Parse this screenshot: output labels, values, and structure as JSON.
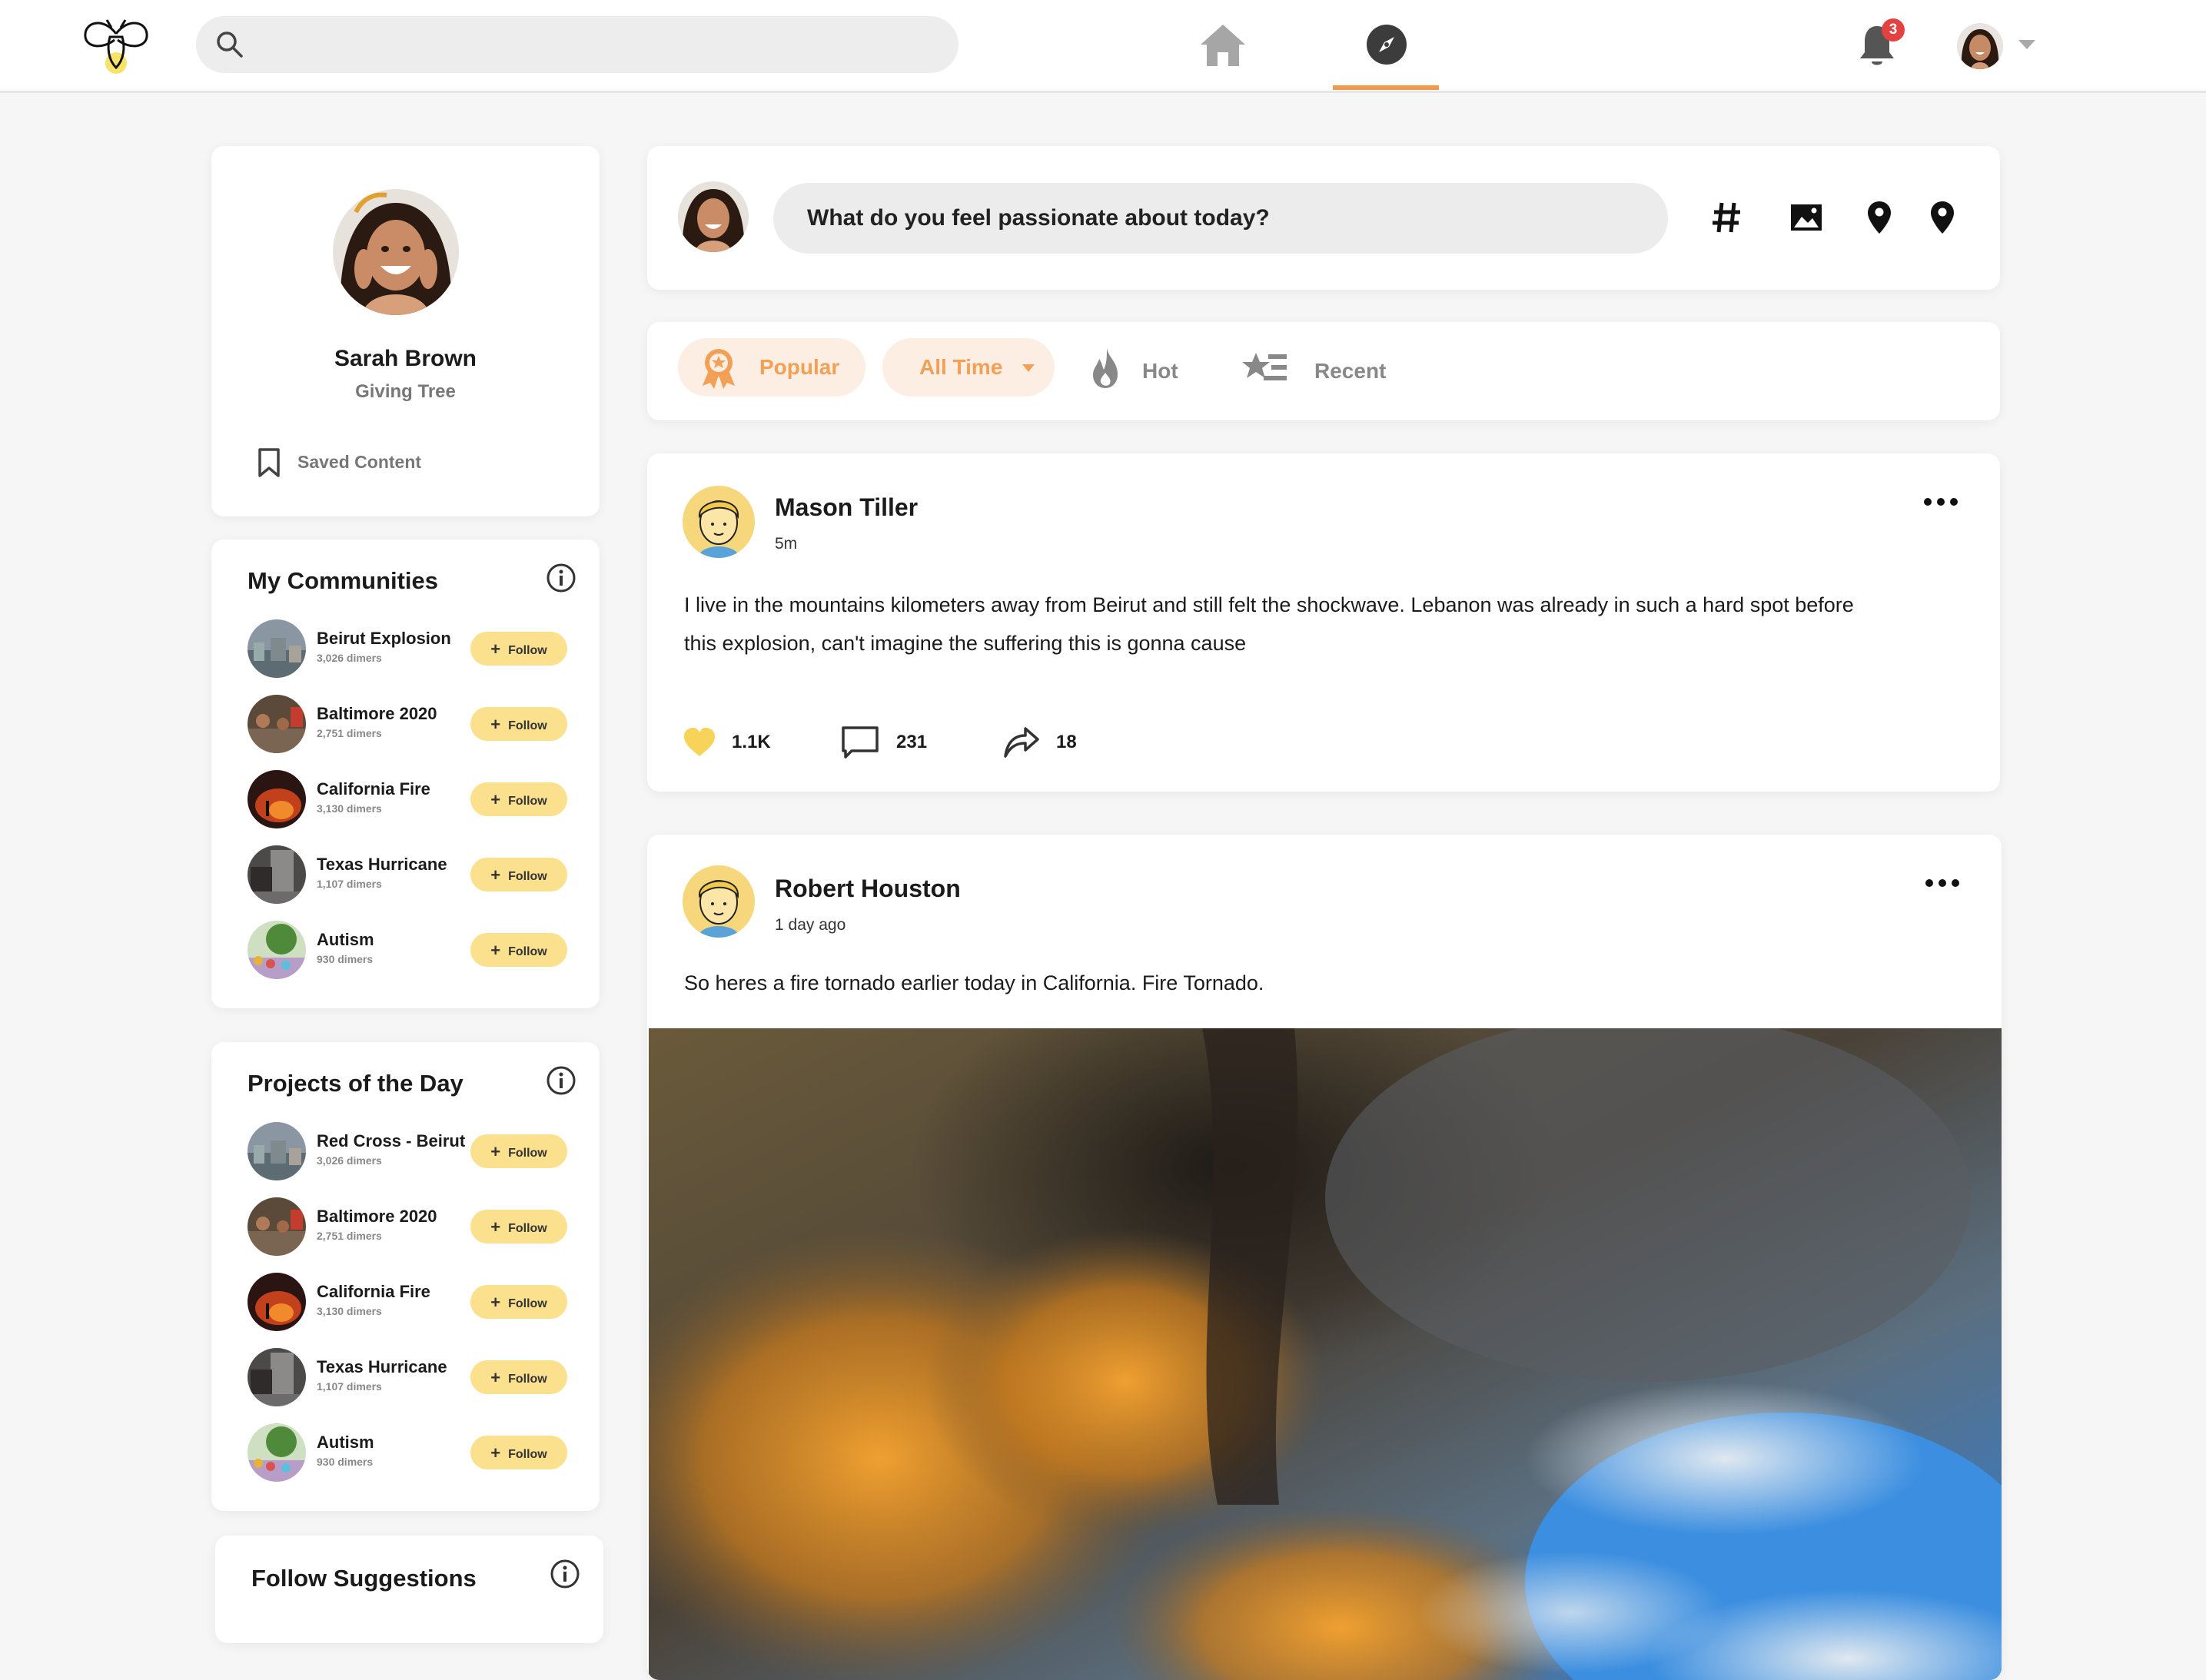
{
  "header": {
    "search_placeholder": "",
    "notification_count": "3"
  },
  "profile": {
    "name": "Sarah Brown",
    "subtitle": "Giving Tree",
    "saved_label": "Saved Content"
  },
  "communities": {
    "title": "My Communities",
    "items": [
      {
        "name": "Beirut Explosion",
        "members": "3,026 dimers",
        "action": "Follow"
      },
      {
        "name": "Baltimore 2020",
        "members": "2,751 dimers",
        "action": "Follow"
      },
      {
        "name": "California Fire",
        "members": "3,130 dimers",
        "action": "Follow"
      },
      {
        "name": "Texas Hurricane",
        "members": "1,107 dimers",
        "action": "Follow"
      },
      {
        "name": "Autism",
        "members": "930 dimers",
        "action": "Follow"
      }
    ]
  },
  "projects": {
    "title": "Projects of the Day",
    "items": [
      {
        "name": "Red Cross - Beirut",
        "members": "3,026 dimers",
        "action": "Follow"
      },
      {
        "name": "Baltimore 2020",
        "members": "2,751 dimers",
        "action": "Follow"
      },
      {
        "name": "California Fire",
        "members": "3,130 dimers",
        "action": "Follow"
      },
      {
        "name": "Texas Hurricane",
        "members": "1,107 dimers",
        "action": "Follow"
      },
      {
        "name": "Autism",
        "members": "930 dimers",
        "action": "Follow"
      }
    ]
  },
  "suggestions": {
    "title": "Follow Suggestions"
  },
  "composer": {
    "placeholder": "What do you feel passionate about today?"
  },
  "filters": {
    "popular": "Popular",
    "time": "All Time",
    "hot": "Hot",
    "recent": "Recent"
  },
  "posts": [
    {
      "author": "Mason Tiller",
      "time": "5m",
      "body": "I live in the mountains kilometers away from Beirut and still felt the shockwave. Lebanon was already in such a hard spot before this explosion, can't imagine the suffering this is gonna cause",
      "likes": "1.1K",
      "comments": "231",
      "shares": "18"
    },
    {
      "author": "Robert Houston",
      "time": "1 day ago",
      "body": "So heres a fire tornado earlier today in California. Fire Tornado."
    }
  ],
  "colors": {
    "accent": "#f19a4b",
    "follow_bg": "#fbe08e",
    "filter_bg": "#fdeee4",
    "badge": "#e44242",
    "like": "#f7d35a"
  }
}
